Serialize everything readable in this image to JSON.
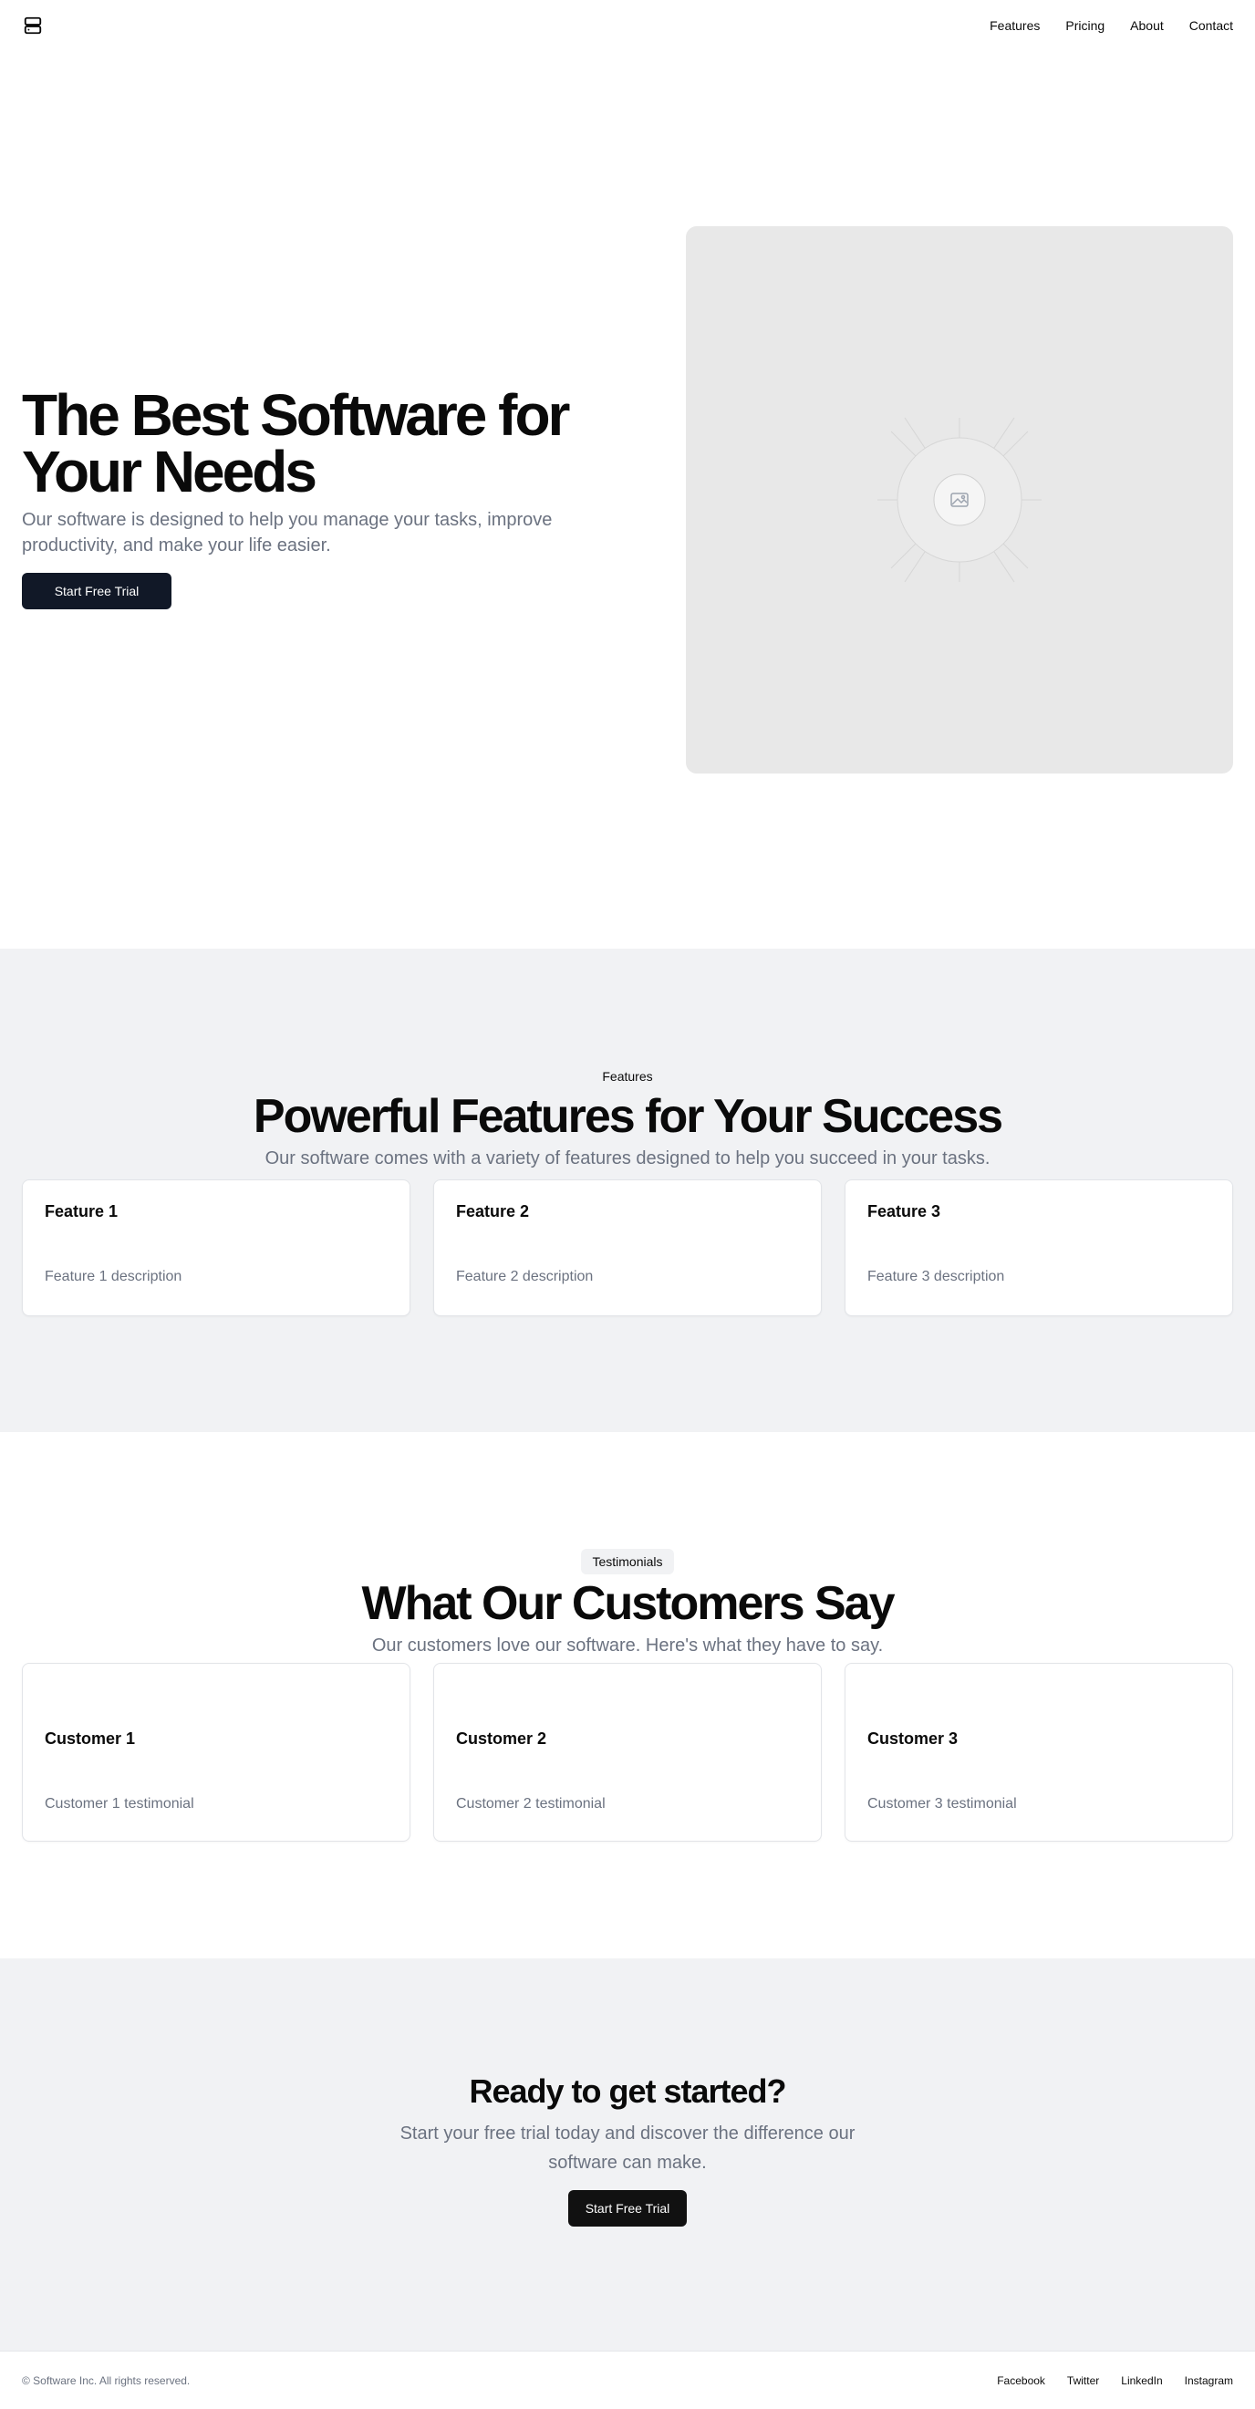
{
  "header": {
    "logo_icon": "server-stack-icon",
    "nav": [
      "Features",
      "Pricing",
      "About",
      "Contact"
    ]
  },
  "hero": {
    "title": "The Best Software for Your Needs",
    "subtitle": "Our software is designed to help you manage your tasks, improve productivity, and make your life easier.",
    "cta_label": "Start Free Trial",
    "image_icon": "image-placeholder-icon"
  },
  "features": {
    "tag": "Features",
    "title": "Powerful Features for Your Success",
    "subtitle": "Our software comes with a variety of features designed to help you succeed in your tasks.",
    "items": [
      {
        "title": "Feature 1",
        "description": "Feature 1 description"
      },
      {
        "title": "Feature 2",
        "description": "Feature 2 description"
      },
      {
        "title": "Feature 3",
        "description": "Feature 3 description"
      }
    ]
  },
  "testimonials": {
    "tag": "Testimonials",
    "title": "What Our Customers Say",
    "subtitle": "Our customers love our software. Here's what they have to say.",
    "items": [
      {
        "name": "Customer 1",
        "text": "Customer 1 testimonial"
      },
      {
        "name": "Customer 2",
        "text": "Customer 2 testimonial"
      },
      {
        "name": "Customer 3",
        "text": "Customer 3 testimonial"
      }
    ]
  },
  "cta": {
    "title": "Ready to get started?",
    "subtitle": "Start your free trial today and discover the difference our software can make.",
    "button_label": "Start Free Trial"
  },
  "footer": {
    "copyright": "© Software Inc. All rights reserved.",
    "links": [
      "Facebook",
      "Twitter",
      "LinkedIn",
      "Instagram"
    ]
  },
  "colors": {
    "primary_button": "#111827",
    "section_bg": "#f1f2f4",
    "muted_text": "#6b7280"
  }
}
